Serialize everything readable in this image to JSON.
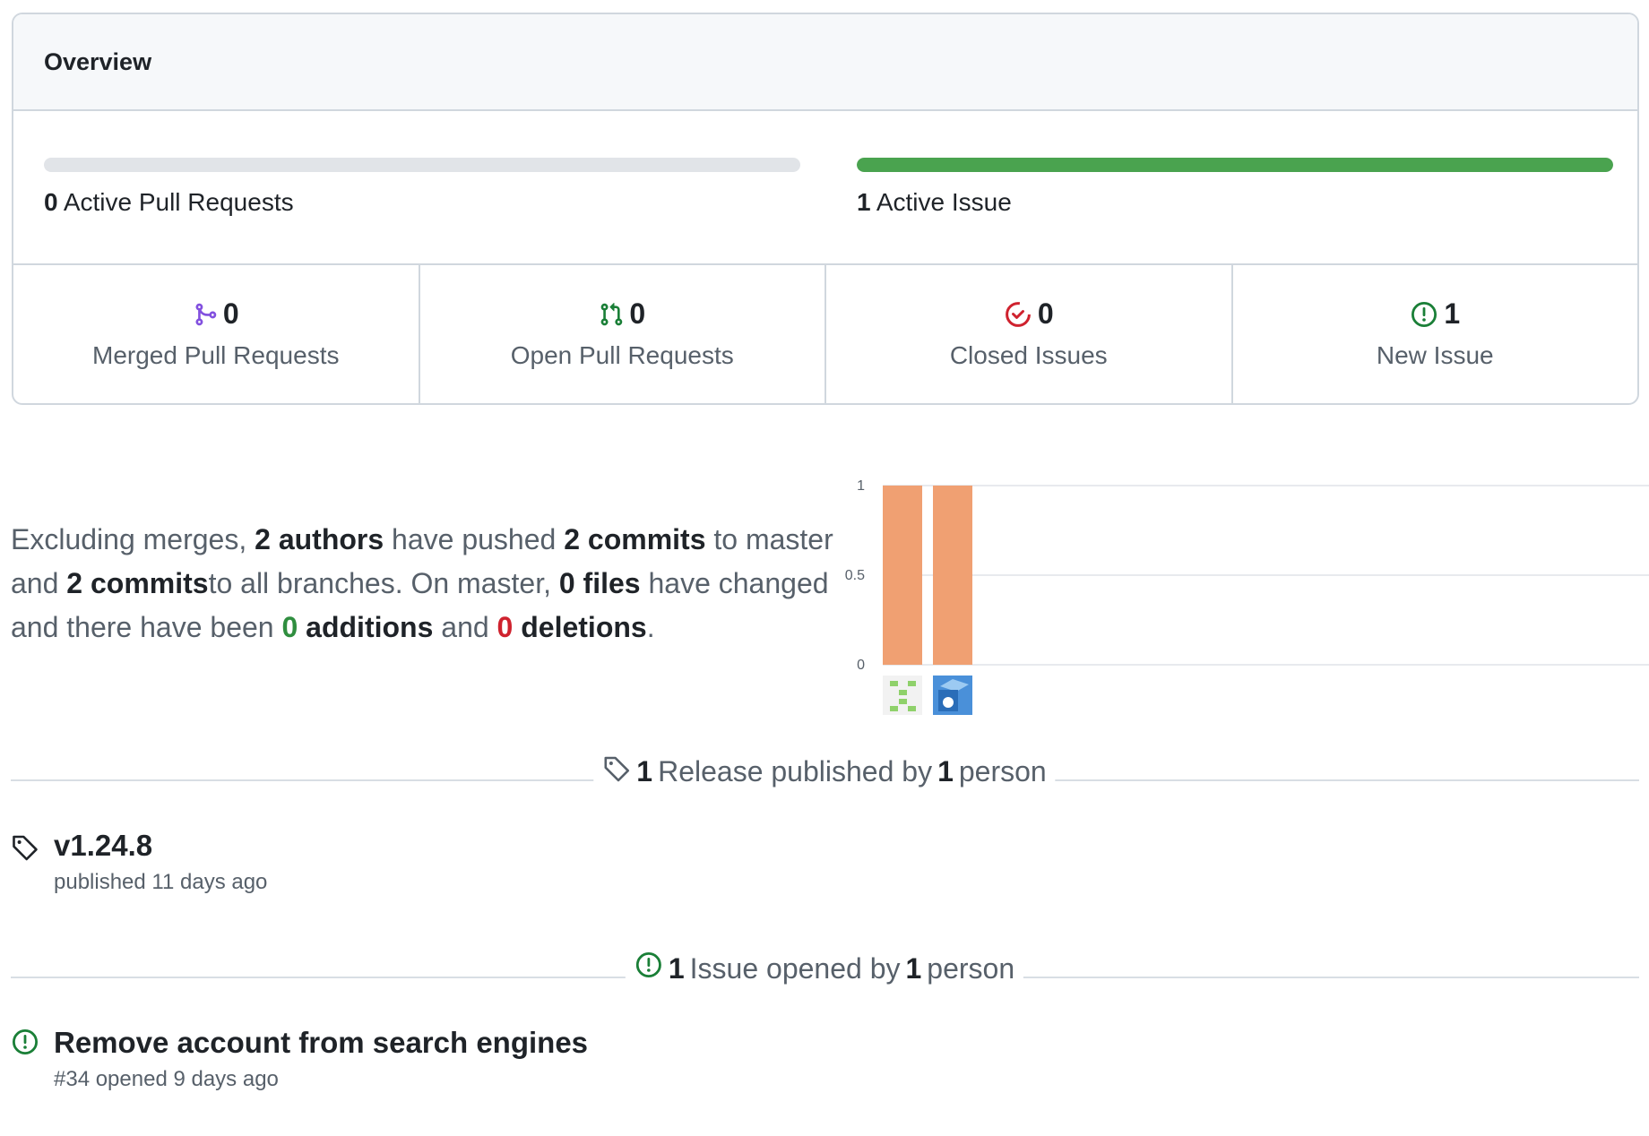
{
  "overview": {
    "title": "Overview",
    "pull_requests_progress": 0,
    "issues_progress": 1,
    "active_pull_requests": {
      "count": "0",
      "label": "Active Pull Requests"
    },
    "active_issues": {
      "count": "1",
      "label": "Active Issue"
    }
  },
  "stats": [
    {
      "count": "0",
      "label": "Merged Pull Requests",
      "icon": "git-merge-icon",
      "color": "#8250df"
    },
    {
      "count": "0",
      "label": "Open Pull Requests",
      "icon": "git-pull-request-icon",
      "color": "#1a7f37"
    },
    {
      "count": "0",
      "label": "Closed Issues",
      "icon": "issue-closed-icon",
      "color": "#cf222e"
    },
    {
      "count": "1",
      "label": "New Issue",
      "icon": "issue-opened-icon",
      "color": "#1a7f37"
    }
  ],
  "summary": {
    "p1": "Excluding merges,",
    "authors": "2 authors",
    "p2": "have pushed",
    "commits_master": "2 commits",
    "p3": "to master and",
    "commits_all": "2 commits",
    "p4": "to all branches. On master,",
    "files": "0 files",
    "p5": "have changed and there have been",
    "additions_num": "0",
    "additions_label": "additions",
    "p6": "and",
    "deletions_num": "0",
    "deletions_label": "deletions",
    "p7": "."
  },
  "chart_data": {
    "type": "bar",
    "categories": [
      "author-1",
      "author-2"
    ],
    "values": [
      1,
      1
    ],
    "ylim": [
      0,
      1
    ],
    "yticks": [
      "0",
      "0.5",
      "1"
    ],
    "bar_color": "#ef9b6a",
    "grid": true
  },
  "releases": {
    "count": "1",
    "text1": "Release published by",
    "people": "1",
    "text2": "person",
    "items": [
      {
        "title": "v1.24.8",
        "subtitle": "published 11 days ago"
      }
    ]
  },
  "issues": {
    "count": "1",
    "text1": "Issue opened by",
    "people": "1",
    "text2": "person",
    "items": [
      {
        "title": "Remove account from search engines",
        "subtitle": "#34 opened 9 days ago"
      }
    ]
  }
}
